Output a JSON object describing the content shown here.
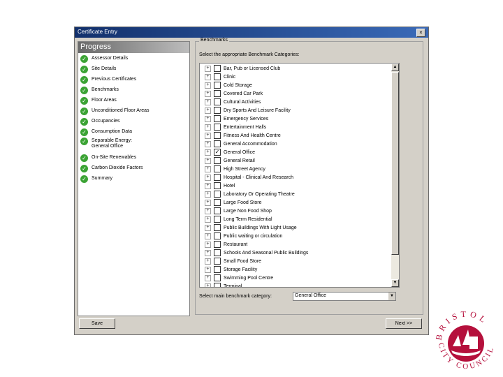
{
  "window": {
    "title": "Certificate Entry",
    "close_glyph": "×"
  },
  "progress": {
    "header": "Progress",
    "steps": [
      {
        "label": "Assessor Details",
        "status": "complete"
      },
      {
        "label": "Site Details",
        "status": "complete"
      },
      {
        "label": "Previous Certificates",
        "status": "complete"
      },
      {
        "label": "Benchmarks",
        "status": "complete"
      },
      {
        "label": "Floor Areas",
        "status": "complete"
      },
      {
        "label": "Unconditioned Floor Areas",
        "status": "complete"
      },
      {
        "label": "Occupancies",
        "status": "complete"
      },
      {
        "label": "Consumption Data",
        "status": "complete"
      },
      {
        "label": "Separable Energy: General Office",
        "status": "complete"
      },
      {
        "label": "On-Site Renewables",
        "status": "complete"
      },
      {
        "label": "Carbon Dioxide Factors",
        "status": "complete"
      },
      {
        "label": "Summary",
        "status": "complete"
      }
    ]
  },
  "benchmarks": {
    "group_title": "Benchmarks",
    "instruction": "Select the appropriate Benchmark Categories:",
    "categories": [
      {
        "label": "Bar, Pub or Licensed Club",
        "checked": false
      },
      {
        "label": "Clinic",
        "checked": false
      },
      {
        "label": "Cold Storage",
        "checked": false
      },
      {
        "label": "Covered Car Park",
        "checked": false
      },
      {
        "label": "Cultural Activities",
        "checked": false
      },
      {
        "label": "Dry Sports And Leisure Facility",
        "checked": false
      },
      {
        "label": "Emergency Services",
        "checked": false
      },
      {
        "label": "Entertainment Halls",
        "checked": false
      },
      {
        "label": "Fitness And Health Centre",
        "checked": false
      },
      {
        "label": "General Accommodation",
        "checked": false
      },
      {
        "label": "General Office",
        "checked": true
      },
      {
        "label": "General Retail",
        "checked": false
      },
      {
        "label": "High Street Agency",
        "checked": false
      },
      {
        "label": "Hospital - Clinical And Research",
        "checked": false
      },
      {
        "label": "Hotel",
        "checked": false
      },
      {
        "label": "Laboratory Or Operating Theatre",
        "checked": false
      },
      {
        "label": "Large Food Store",
        "checked": false
      },
      {
        "label": "Large Non Food Shop",
        "checked": false
      },
      {
        "label": "Long Term Residential",
        "checked": false
      },
      {
        "label": "Public Buildings With Light Usage",
        "checked": false
      },
      {
        "label": "Public waiting or circulation",
        "checked": false
      },
      {
        "label": "Restaurant",
        "checked": false
      },
      {
        "label": "Schools And Seasonal Public Buildings",
        "checked": false
      },
      {
        "label": "Small Food Store",
        "checked": false
      },
      {
        "label": "Storage Facility",
        "checked": false
      },
      {
        "label": "Swimming Pool Centre",
        "checked": false
      },
      {
        "label": "Terminal",
        "checked": false
      }
    ],
    "main_label": "Select main benchmark category:",
    "main_value": "General Office"
  },
  "buttons": {
    "save": "Save",
    "next": "Next >>"
  },
  "logo": {
    "text_top": "BRISTOL",
    "text_bottom": "CITY COUNCIL",
    "color": "#b5103c"
  },
  "colors": {
    "titlebar": "#12306c",
    "check": "#3ba334"
  }
}
